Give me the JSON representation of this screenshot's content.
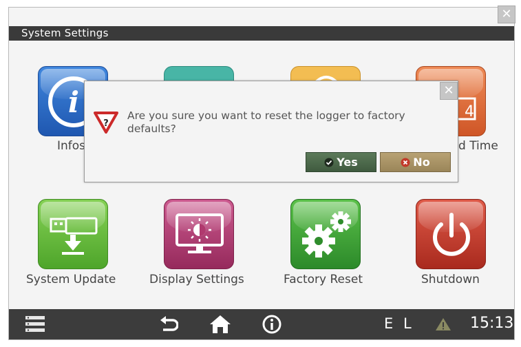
{
  "window": {
    "title": "System Settings",
    "close_glyph": "✕"
  },
  "tiles": [
    {
      "label": "Infos",
      "icon": "info-icon",
      "color": "#2e6fc9"
    },
    {
      "label": "",
      "icon": "teal-app-icon",
      "color": "#3aa89a"
    },
    {
      "label": "",
      "icon": "yellow-app-icon",
      "color": "#f1b23a"
    },
    {
      "label": "d Time",
      "icon": "calendar-icon",
      "color": "#dd6a3a"
    },
    {
      "label": "System Update",
      "icon": "usb-download-icon",
      "color": "#6fbe3e"
    },
    {
      "label": "Display Settings",
      "icon": "monitor-brightness-icon",
      "color": "#b2386f"
    },
    {
      "label": "Factory Reset",
      "icon": "gears-icon",
      "color": "#3e9e3a"
    },
    {
      "label": "Shutdown",
      "icon": "power-icon",
      "color": "#c53a2e"
    }
  ],
  "dialog": {
    "message": "Are you sure you want to reset the logger to factory defaults?",
    "icon": "warning-question-icon",
    "yes_label": "Yes",
    "no_label": "No",
    "yes_icon": "check-circle-icon",
    "no_icon": "x-circle-icon",
    "close_glyph": "✕"
  },
  "taskbar": {
    "menu_icon": "menu-icon",
    "back_icon": "back-icon",
    "home_icon": "home-icon",
    "info_icon": "info-circle-icon",
    "status_e": "E",
    "status_l": "L",
    "warning_icon": "warning-icon",
    "time": "15:13"
  }
}
